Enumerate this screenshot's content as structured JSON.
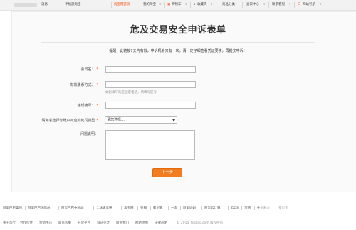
{
  "topbar": {
    "messages": "消息",
    "mobile": "手机逛淘宝",
    "taobao_home": "淘宝网首页",
    "my_taobao": "我的淘宝",
    "cart": "购物车",
    "favorites": "收藏夹",
    "categories": "商品分类",
    "seller_center": "卖家中心",
    "customer_service": "联系客服",
    "site_nav": "网站导航"
  },
  "page": {
    "title": "危及交易安全申诉表单",
    "notice": "提醒：此链接7天内有效，申诉机会只有一次，请一定仔细查看凭证要求，再提交申诉！"
  },
  "form": {
    "member_label": "会员名：",
    "member_value": "",
    "contact_label": "有效联系方式：",
    "contact_value": "",
    "contact_hint": "如您填写的是固定电话，请填写区号",
    "order_label": "违规编号：",
    "order_value": "",
    "type_label": "请务必选择您账户对应的处罚类型",
    "type_selected": "请您选择…",
    "issue_label": "问题说明：",
    "next_button": "下一步"
  },
  "footer": {
    "links": [
      "阿里巴巴集团",
      "阿里巴巴国际站",
      "阿里巴巴中国站",
      "全球速卖通",
      "淘宝网",
      "天猫",
      "聚划算",
      "一淘",
      "阿里妈妈",
      "阿里云计算",
      "云OS",
      "万网",
      "中国雅虎",
      "支付宝"
    ],
    "bottom_links": [
      "关于淘宝",
      "合作伙伴",
      "营销中心",
      "联系客服",
      "开放平台",
      "诚征英才",
      "联系我们",
      "网站地图",
      "法律声明"
    ],
    "copyright": "© 2015 Taobao.com 版权所有"
  }
}
